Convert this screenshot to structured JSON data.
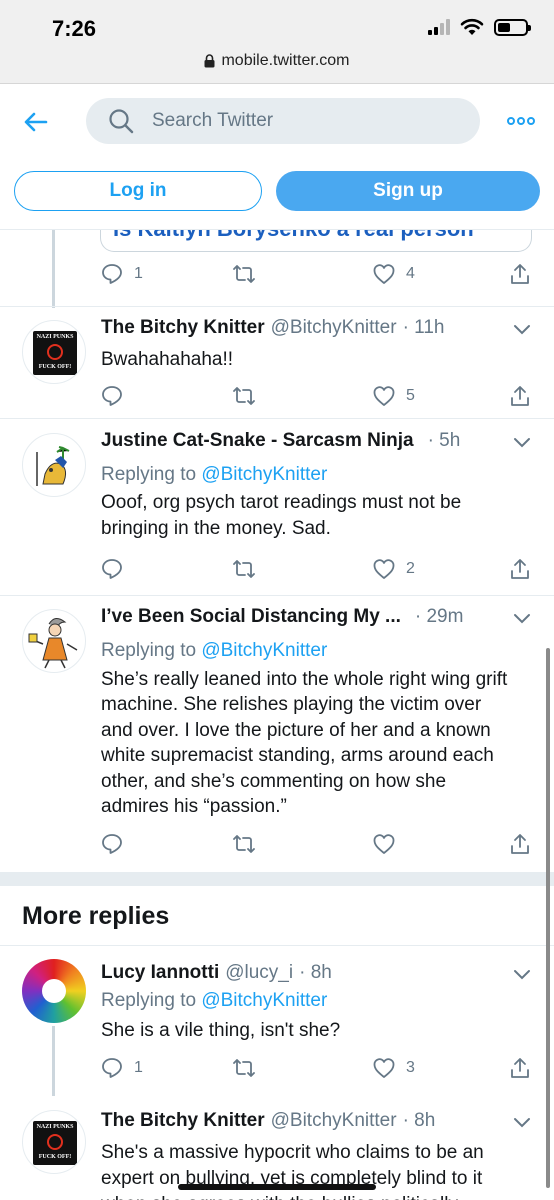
{
  "status_bar": {
    "time": "7:26",
    "url": "mobile.twitter.com"
  },
  "header": {
    "search_placeholder": "Search Twitter",
    "login_label": "Log in",
    "signup_label": "Sign up"
  },
  "partial_card_text": "Is Kaitlyn Borysenko a real person",
  "top_actions": {
    "replies": "1",
    "retweets": "",
    "likes": "4"
  },
  "tweets": [
    {
      "name": "The Bitchy Knitter",
      "handle": "@BitchyKnitter",
      "time": "· 11h",
      "reply_prefix": "",
      "reply_to": "",
      "text": "Bwahahahaha!!",
      "replies": "",
      "likes": "5",
      "avatar": "nazi-punks-fuck-off-avatar"
    },
    {
      "name": "Justine Cat-Snake - Sarcasm Ninja",
      "handle": "",
      "time": "· 5h",
      "reply_prefix": "Replying to ",
      "reply_to": "@BitchyKnitter",
      "text": "Ooof, org psych tarot readings must not be bringing in the money. Sad.",
      "replies": "",
      "likes": "2",
      "avatar": "egyptian-cat-drawing-avatar"
    },
    {
      "name": "I’ve Been Social Distancing My ...",
      "handle": "",
      "time": "· 29m",
      "reply_prefix": "Replying to ",
      "reply_to": "@BitchyKnitter",
      "text": "She’s really leaned into the whole right wing grift machine. She relishes playing the victim over and over. I love the picture of her and a known white supremacist standing, arms around each other, and she’s commenting on how she admires his “passion.”",
      "replies": "",
      "likes": "",
      "avatar": "cartoon-character-avatar"
    }
  ],
  "more_replies_title": "More replies",
  "more_tweets": [
    {
      "name": "Lucy Iannotti",
      "handle": "@lucy_i",
      "time": "· 8h",
      "reply_prefix": "Replying to ",
      "reply_to": "@BitchyKnitter",
      "text": "She is a vile thing, isn't she?",
      "replies": "1",
      "likes": "3",
      "avatar": "color-wheel-avatar"
    },
    {
      "name": "The Bitchy Knitter",
      "handle": "@BitchyKnitter",
      "time": "· 8h",
      "reply_prefix": "",
      "reply_to": "",
      "text": "She's a massive hypocrit who claims to be an expert on bullying, yet is completely blind to it when she agrees with the bullies politically.",
      "replies": "",
      "likes": "",
      "avatar": "nazi-punks-fuck-off-avatar"
    }
  ],
  "avatar_text": {
    "line1": "NAZI PUNKS",
    "line2": "FUCK OFF!"
  },
  "colors": {
    "accent": "#1da1f2",
    "secondary_text": "#657786",
    "divider": "#e6ecf0"
  }
}
